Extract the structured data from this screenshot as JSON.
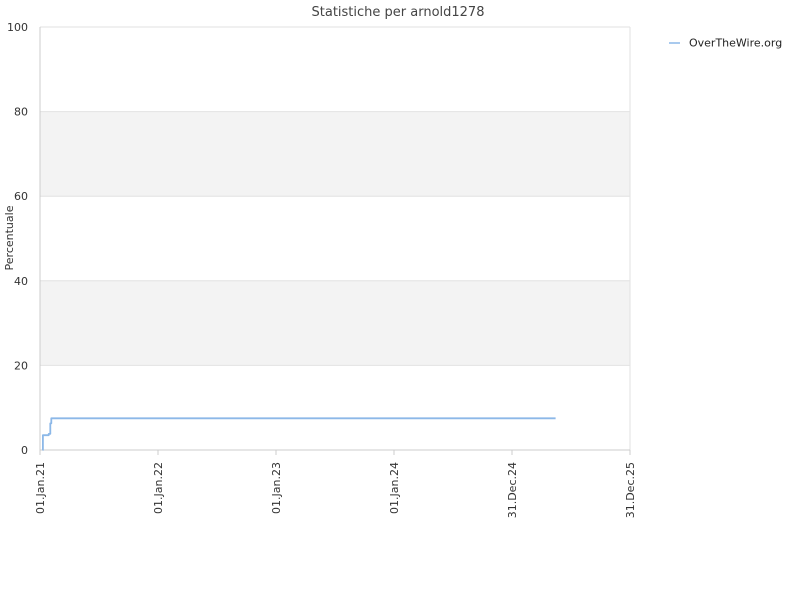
{
  "chart_data": {
    "type": "line",
    "title": "Statistiche per arnold1278",
    "ylabel": "Percentuale",
    "xlabel": "",
    "ylim": [
      0,
      100
    ],
    "yticks": [
      0,
      20,
      40,
      60,
      80,
      100
    ],
    "xlim": [
      "2021-01-01",
      "2025-12-31"
    ],
    "xticks": [
      {
        "label": "01.Jan.21",
        "date": "2021-01-01"
      },
      {
        "label": "01.Jan.22",
        "date": "2022-01-01"
      },
      {
        "label": "01.Jan.23",
        "date": "2023-01-01"
      },
      {
        "label": "01.Jan.24",
        "date": "2024-01-01"
      },
      {
        "label": "31.Dec.24",
        "date": "2024-12-31"
      },
      {
        "label": "31.Dec.25",
        "date": "2025-12-31"
      }
    ],
    "grid": true,
    "alternating_bands": true,
    "legend_position": "top-right",
    "series": [
      {
        "name": "OverTheWire.org",
        "color": "#8cb8e8",
        "step": true,
        "points": [
          {
            "x": "2021-01-09",
            "y": 0
          },
          {
            "x": "2021-01-10",
            "y": 3.5
          },
          {
            "x": "2021-01-28",
            "y": 3.8
          },
          {
            "x": "2021-02-02",
            "y": 6.3
          },
          {
            "x": "2021-02-05",
            "y": 7.5
          },
          {
            "x": "2025-05-15",
            "y": 7.5
          }
        ]
      }
    ],
    "colors": {
      "band": "#f3f3f3",
      "grid": "#e2e2e2",
      "axis": "#cccccc"
    }
  }
}
